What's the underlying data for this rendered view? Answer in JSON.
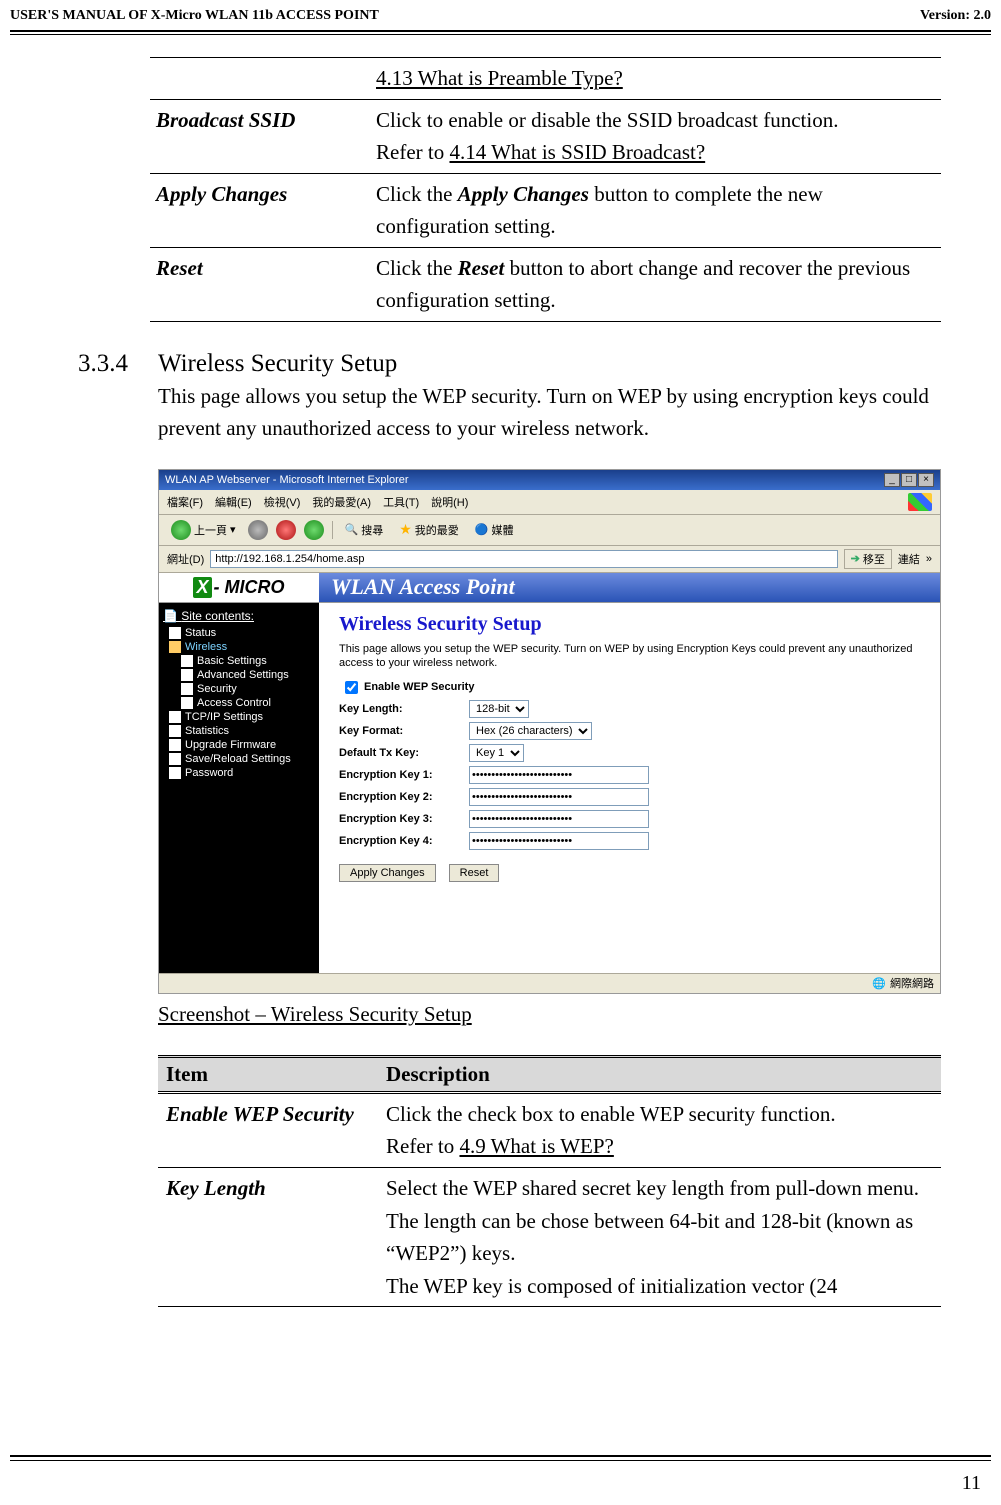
{
  "header": {
    "title": "USER'S MANUAL OF X-Micro WLAN 11b ACCESS POINT",
    "version": "Version: 2.0"
  },
  "top_table": {
    "preamble_link": "4.13 What is Preamble Type?",
    "rows": [
      {
        "label": "Broadcast SSID",
        "text_a": "Click to enable or disable the SSID broadcast function.",
        "text_b": "Refer to ",
        "link": "4.14 What is SSID Broadcast?"
      },
      {
        "label": "Apply Changes",
        "text_a": "Click the ",
        "em": "Apply Changes",
        "text_b": " button to complete the new configuration setting."
      },
      {
        "label": "Reset",
        "text_a": "Click the ",
        "em": "Reset",
        "text_b": " button to abort change and recover the previous configuration setting."
      }
    ]
  },
  "section": {
    "num": "3.3.4",
    "title": "Wireless Security Setup",
    "body": "This page allows you setup the WEP security. Turn on WEP by using encryption keys could prevent any unauthorized access to your wireless network."
  },
  "screenshot": {
    "window_title": "WLAN AP Webserver - Microsoft Internet Explorer",
    "menus": [
      "檔案(F)",
      "編輯(E)",
      "檢視(V)",
      "我的最愛(A)",
      "工具(T)",
      "說明(H)"
    ],
    "toolbar": {
      "back": "上一頁",
      "search": "搜尋",
      "favorites": "我的最愛",
      "media": "媒體"
    },
    "address_label": "網址(D)",
    "address": "http://192.168.1.254/home.asp",
    "go": "移至",
    "links": "連結",
    "logo": {
      "x": "X",
      "rest": "- MICRO"
    },
    "banner": "WLAN Access Point",
    "sidebar": {
      "header": "Site contents:",
      "items": [
        {
          "label": "Status",
          "indent": false
        },
        {
          "label": "Wireless",
          "indent": false,
          "sel": true
        },
        {
          "label": "Basic Settings",
          "indent": true
        },
        {
          "label": "Advanced Settings",
          "indent": true
        },
        {
          "label": "Security",
          "indent": true
        },
        {
          "label": "Access Control",
          "indent": true
        },
        {
          "label": "TCP/IP Settings",
          "indent": false
        },
        {
          "label": "Statistics",
          "indent": false
        },
        {
          "label": "Upgrade Firmware",
          "indent": false
        },
        {
          "label": "Save/Reload Settings",
          "indent": false
        },
        {
          "label": "Password",
          "indent": false
        }
      ]
    },
    "main": {
      "heading": "Wireless Security Setup",
      "intro": "This page allows you setup the WEP security. Turn on WEP by using Encryption Keys could prevent any unauthorized access to your wireless network.",
      "enable_label": "Enable WEP Security",
      "rows": [
        {
          "label": "Key Length:",
          "type": "select",
          "value": "128-bit"
        },
        {
          "label": "Key Format:",
          "type": "select",
          "value": "Hex (26 characters)"
        },
        {
          "label": "Default Tx Key:",
          "type": "select",
          "value": "Key 1"
        },
        {
          "label": "Encryption Key 1:",
          "type": "password",
          "value": "**************************"
        },
        {
          "label": "Encryption Key 2:",
          "type": "password",
          "value": "**************************"
        },
        {
          "label": "Encryption Key 3:",
          "type": "password",
          "value": "**************************"
        },
        {
          "label": "Encryption Key 4:",
          "type": "password",
          "value": "**************************"
        }
      ],
      "apply": "Apply Changes",
      "reset": "Reset"
    },
    "status_zone": "網際網路"
  },
  "caption": "Screenshot – Wireless Security Setup",
  "desc_table": {
    "headers": [
      "Item",
      "Description"
    ],
    "rows": [
      {
        "label": "Enable WEP Security",
        "text_a": "Click the check box to enable WEP security function.",
        "text_b": "Refer to ",
        "link": "4.9 What is WEP?"
      },
      {
        "label": "Key Length",
        "text": "Select the WEP shared secret key length from pull-down menu. The length can be chose between 64-bit and 128-bit (known as “WEP2”) keys.\nThe WEP key is composed of initialization vector (24"
      }
    ]
  },
  "page_number": "11"
}
